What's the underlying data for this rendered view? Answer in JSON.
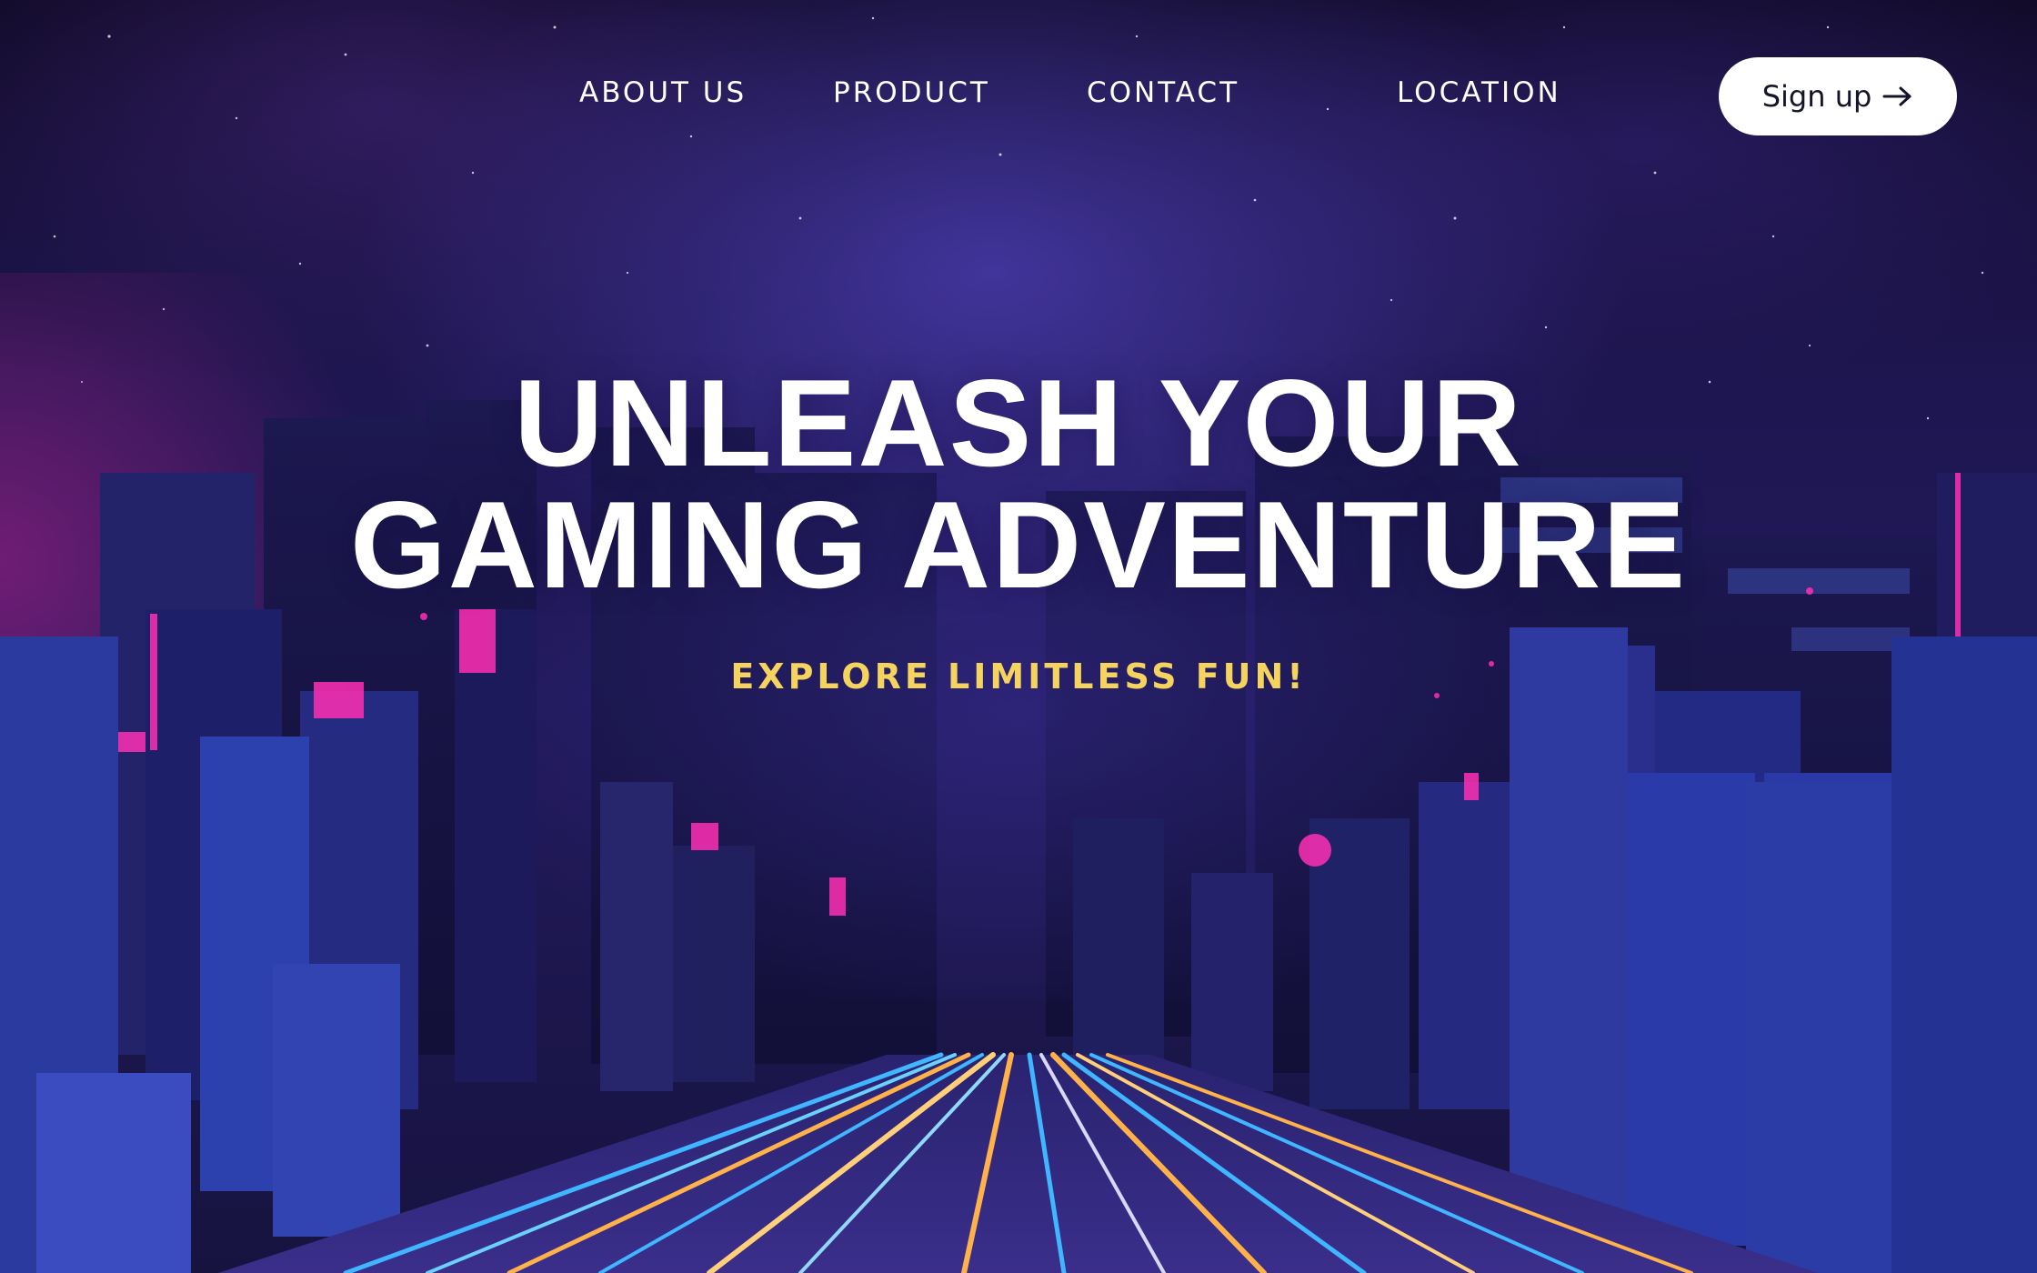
{
  "nav": {
    "items": [
      {
        "label": "ABOUT US"
      },
      {
        "label": "PRODUCT"
      },
      {
        "label": "CONTACT"
      },
      {
        "label": "LOCATION"
      }
    ],
    "signup_label": "Sign up",
    "signup_icon": "arrow-right-icon"
  },
  "hero": {
    "title_line1": "UNLEASH YOUR",
    "title_line2": "GAMING ADVENTURE",
    "tagline": "EXPLORE LIMITLESS FUN!"
  },
  "colors": {
    "tagline": "#f4d35e",
    "button_bg": "#ffffff",
    "sky": "#1e1650",
    "neon_pink": "#ff2fb4",
    "light_blue": "#3fb6ff",
    "light_orange": "#ffb24a"
  }
}
